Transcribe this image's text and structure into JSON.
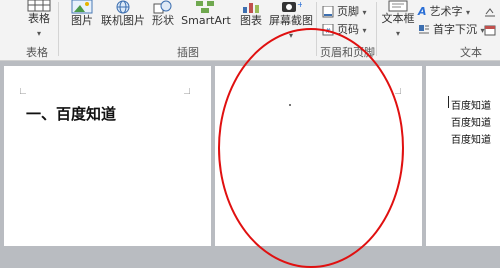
{
  "ribbon": {
    "table": {
      "label": "表格",
      "group": "表格"
    },
    "illustrations": {
      "group": "插图",
      "buttons": [
        {
          "label": "图片",
          "icon": "picture-icon"
        },
        {
          "label": "联机图片",
          "icon": "online-picture-icon"
        },
        {
          "label": "形状",
          "icon": "shapes-icon"
        },
        {
          "label": "SmartArt",
          "icon": "smartart-icon"
        },
        {
          "label": "图表",
          "icon": "chart-icon"
        },
        {
          "label": "屏幕截图",
          "icon": "screenshot-icon"
        }
      ]
    },
    "header_footer": {
      "group": "页眉和页脚",
      "footer": "页脚",
      "page_number": "页码"
    },
    "text": {
      "group": "文本",
      "textbox": "文本框",
      "wordart": "艺术字",
      "dropcap": "首字下沉"
    }
  },
  "document": {
    "page1_heading": "一、百度知道",
    "page3_lines": [
      "百度知道",
      "百度知道",
      "百度知道"
    ]
  },
  "colors": {
    "annotation": "#e01010"
  }
}
